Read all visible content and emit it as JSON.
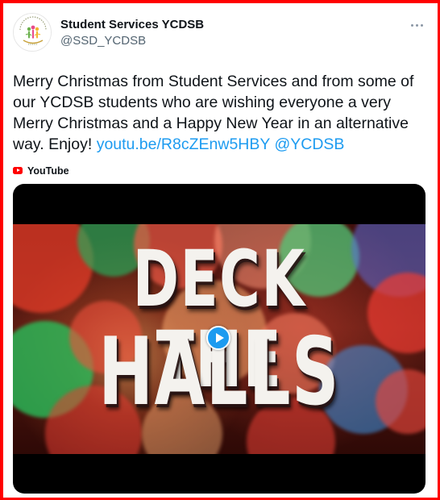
{
  "tweet": {
    "author": {
      "display_name": "Student Services YCDSB",
      "handle": "@SSD_YCDSB"
    },
    "text": "Merry Christmas from Student Services and from some of our YCDSB students who are wishing everyone a very Merry Christmas and a Happy New Year in an alternative way. Enjoy!",
    "link_url_text": "youtu.be/R8cZEnw5HBY",
    "mention": "@YCDSB",
    "media_source": "YouTube",
    "video": {
      "title_line1": "DECK THE",
      "title_line2": "HALLS"
    }
  },
  "icons": {
    "more": "more-dots-icon",
    "source": "youtube-icon",
    "play": "play-icon"
  },
  "colors": {
    "frame": "#ff0000",
    "link": "#1d9bf0",
    "text": "#0f1419",
    "secondary_text": "#536471",
    "play_button": "#1d9bf0"
  }
}
